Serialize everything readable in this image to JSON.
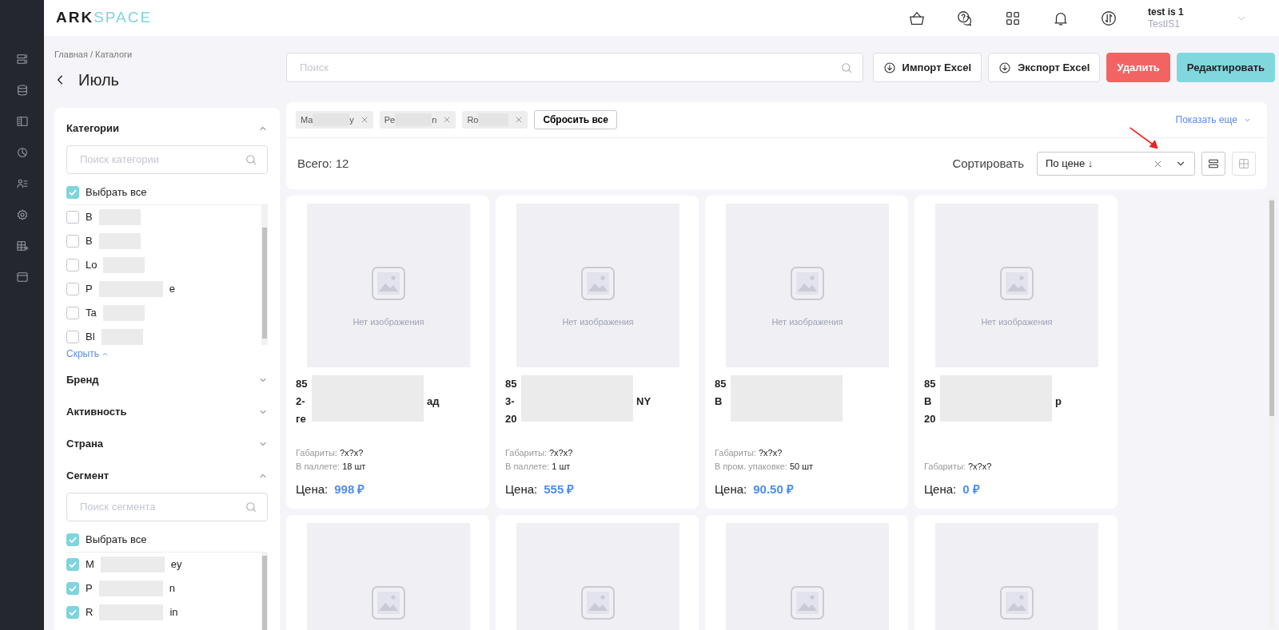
{
  "logo": {
    "primary": "ARK",
    "secondary": "SPACE"
  },
  "user": {
    "name": "test is 1",
    "org": "TestIS1"
  },
  "breadcrumb": "Главная / Каталоги",
  "page_title": "Июль",
  "search": {
    "placeholder": "Поиск"
  },
  "buttons": [
    {
      "label": "Импорт Excel",
      "kind": "download"
    },
    {
      "label": "Экспорт Excel",
      "kind": "download"
    },
    {
      "label": "Удалить",
      "kind": "danger"
    },
    {
      "label": "Редактировать",
      "kind": "accent"
    }
  ],
  "filters": [
    {
      "title": "Категории",
      "expanded": true,
      "search_placeholder": "Поиск категории",
      "select_all": {
        "label": "Выбрать все",
        "checked": true
      },
      "items": [
        {
          "start": "B",
          "checked": false
        },
        {
          "start": "B",
          "checked": false
        },
        {
          "start": "Lo",
          "checked": false
        },
        {
          "start": "P",
          "end": "e",
          "checked": false
        },
        {
          "start": "Ta",
          "checked": false
        },
        {
          "start": "Bl",
          "checked": false
        }
      ],
      "toggle_link": "Скрыть"
    },
    {
      "title": "Бренд",
      "expanded": false
    },
    {
      "title": "Активность",
      "expanded": false
    },
    {
      "title": "Страна",
      "expanded": false
    },
    {
      "title": "Сегмент",
      "expanded": true,
      "search_placeholder": "Поиск сегмента",
      "select_all": {
        "label": "Выбрать все",
        "checked": true
      },
      "items": [
        {
          "start": "M",
          "end": "ey",
          "checked": true
        },
        {
          "start": "P",
          "end": "n",
          "checked": true
        },
        {
          "start": "R",
          "end": "in",
          "checked": true
        }
      ]
    }
  ],
  "chips": [
    {
      "start": "Ma",
      "end": "y"
    },
    {
      "start": "Pe",
      "end": "n"
    },
    {
      "start": "Ro"
    }
  ],
  "reset_all": "Сбросить все",
  "show_more": "Показать еще",
  "total": "Всего: 12",
  "sort": {
    "label": "Сортировать",
    "value": "По цене ↓"
  },
  "cards": [
    {
      "no_image_text": "Нет изображения",
      "title_lines": [
        {
          "start": "85"
        },
        {
          "start": "2-",
          "end": "ад"
        },
        {
          "start": "ге"
        }
      ],
      "details": [
        {
          "label": "Габариты:",
          "value": "?x?x?"
        },
        {
          "label": "В паллете:",
          "value": "18 шт"
        }
      ],
      "price_label": "Цена:",
      "price": "998 ₽"
    },
    {
      "no_image_text": "Нет изображения",
      "title_lines": [
        {
          "start": "85"
        },
        {
          "start": "3-",
          "end": "NY"
        },
        {
          "start": "20"
        }
      ],
      "details": [
        {
          "label": "Габариты:",
          "value": "?x?x?"
        },
        {
          "label": "В паллете:",
          "value": "1 шт"
        }
      ],
      "price_label": "Цена:",
      "price": "555 ₽"
    },
    {
      "no_image_text": "Нет изображения",
      "title_lines": [
        {
          "start": "85"
        },
        {
          "start": "B"
        }
      ],
      "details": [
        {
          "label": "Габариты:",
          "value": "?x?x?"
        },
        {
          "label": "В пром. упаковке:",
          "value": "50 шт"
        }
      ],
      "price_label": "Цена:",
      "price": "90.50 ₽"
    },
    {
      "no_image_text": "Нет изображения",
      "title_lines": [
        {
          "start": "85"
        },
        {
          "start": "B",
          "end": "р"
        },
        {
          "start": "20"
        }
      ],
      "details": [
        {
          "label": "Габариты:",
          "value": "?x?x?"
        }
      ],
      "price_label": "Цена:",
      "price": "0 ₽"
    },
    {
      "kind": "cut-off"
    },
    {
      "kind": "cut-off"
    },
    {
      "kind": "cut-off"
    },
    {
      "kind": "cut-off"
    }
  ]
}
